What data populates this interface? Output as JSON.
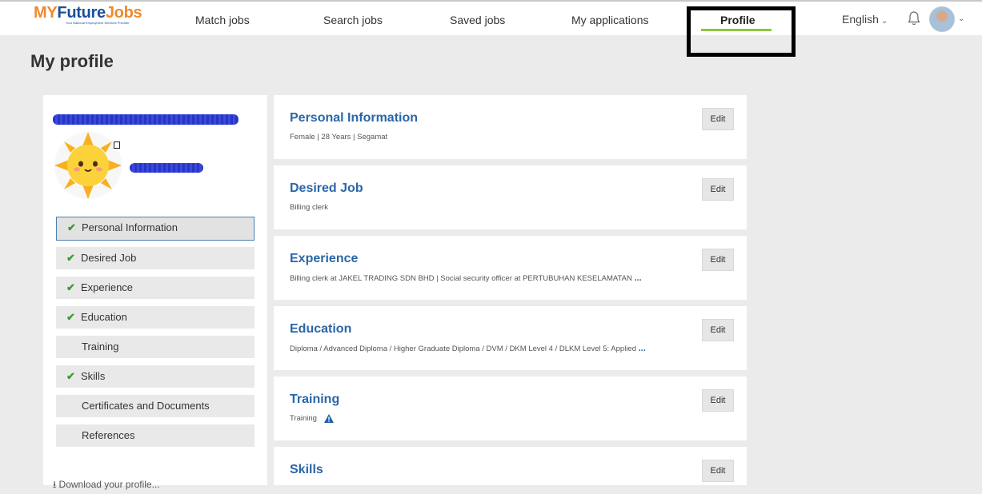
{
  "header": {
    "logo": {
      "my": "MY",
      "future": "Future",
      "jobs": "Jobs",
      "tagline": "Your National Employment Services Provider"
    },
    "nav": [
      {
        "label": "Match jobs"
      },
      {
        "label": "Search jobs"
      },
      {
        "label": "Saved jobs"
      },
      {
        "label": "My applications"
      },
      {
        "label": "Profile",
        "active": true
      }
    ],
    "language": "English",
    "icons": {
      "bell": "bell-icon",
      "avatar": "user-avatar",
      "chevron": "chevron-down-icon"
    }
  },
  "page": {
    "title": "My profile"
  },
  "sidebar": {
    "items": [
      {
        "label": "Personal Information",
        "checked": true,
        "active": true
      },
      {
        "label": "Desired Job",
        "checked": true
      },
      {
        "label": "Experience",
        "checked": true
      },
      {
        "label": "Education",
        "checked": true
      },
      {
        "label": "Training",
        "checked": false
      },
      {
        "label": "Skills",
        "checked": true
      },
      {
        "label": "Certificates and Documents",
        "checked": false
      },
      {
        "label": "References",
        "checked": false
      }
    ],
    "download": "Download your profile..."
  },
  "cards": [
    {
      "title": "Personal Information",
      "subtitle": "Female  |  28 Years  |  Segamat",
      "edit": "Edit"
    },
    {
      "title": "Desired Job",
      "subtitle": "Billing clerk",
      "edit": "Edit"
    },
    {
      "title": "Experience",
      "subtitle": "Billing clerk at JAKEL TRADING SDN BHD   |   Social security officer at PERTUBUHAN KESELAMATAN",
      "more": "...",
      "edit": "Edit"
    },
    {
      "title": "Education",
      "subtitle": "Diploma / Advanced Diploma / Higher Graduate Diploma / DVM / DKM Level 4 / DLKM Level 5: Applied",
      "more": "...",
      "edit": "Edit"
    },
    {
      "title": "Training",
      "subtitle": "Training",
      "edit": "Edit"
    },
    {
      "title": "Skills",
      "subtitle": "",
      "edit": "Edit"
    }
  ],
  "colors": {
    "accent": "#2a66a8",
    "check": "#3d9a35",
    "nav_underline": "#8cc63f",
    "redaction": "#2635c8"
  }
}
